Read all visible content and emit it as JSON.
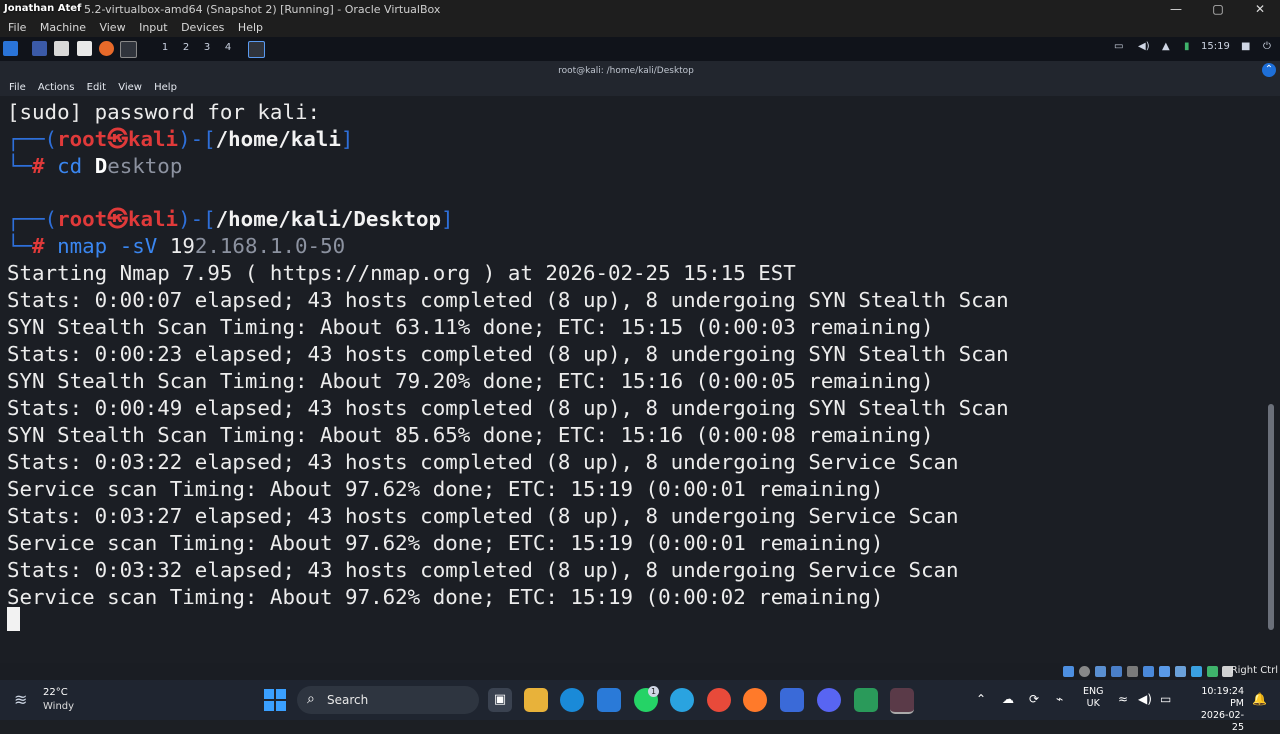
{
  "host_window": {
    "user_badge": "Jonathan Atef",
    "title": "5.2-virtualbox-amd64 (Snapshot 2) [Running] - Oracle VirtualBox",
    "menu": [
      "File",
      "Machine",
      "View",
      "Input",
      "Devices",
      "Help"
    ],
    "controls": {
      "minimize": "—",
      "maximize": "▢",
      "close": "✕"
    }
  },
  "kali_panel": {
    "workspaces": [
      "1",
      "2",
      "3",
      "4"
    ],
    "clock": "15:19"
  },
  "terminal": {
    "title": "root@kali: /home/kali/Desktop",
    "menu": [
      "File",
      "Actions",
      "Edit",
      "View",
      "Help"
    ],
    "sudo_prompt": "[sudo] password for kali:",
    "prompt1": {
      "user": "root",
      "host": "kali",
      "path": "/home/kali",
      "cmd": "cd",
      "arg_bright": "D",
      "arg_dim": "esktop"
    },
    "prompt2": {
      "user": "root",
      "host": "kali",
      "path": "/home/kali/Desktop",
      "cmd": "nmap",
      "flag": "-sV",
      "arg_bright": "19",
      "arg_dim": "2.168.1.0-50"
    },
    "output": [
      "Starting Nmap 7.95 ( https://nmap.org ) at 2026-02-25 15:15 EST",
      "Stats: 0:00:07 elapsed; 43 hosts completed (8 up), 8 undergoing SYN Stealth Scan",
      "SYN Stealth Scan Timing: About 63.11% done; ETC: 15:15 (0:00:03 remaining)",
      "Stats: 0:00:23 elapsed; 43 hosts completed (8 up), 8 undergoing SYN Stealth Scan",
      "SYN Stealth Scan Timing: About 79.20% done; ETC: 15:16 (0:00:05 remaining)",
      "Stats: 0:00:49 elapsed; 43 hosts completed (8 up), 8 undergoing SYN Stealth Scan",
      "SYN Stealth Scan Timing: About 85.65% done; ETC: 15:16 (0:00:08 remaining)",
      "Stats: 0:03:22 elapsed; 43 hosts completed (8 up), 8 undergoing Service Scan",
      "Service scan Timing: About 97.62% done; ETC: 15:19 (0:00:01 remaining)",
      "Stats: 0:03:27 elapsed; 43 hosts completed (8 up), 8 undergoing Service Scan",
      "Service scan Timing: About 97.62% done; ETC: 15:19 (0:00:01 remaining)",
      "Stats: 0:03:32 elapsed; 43 hosts completed (8 up), 8 undergoing Service Scan",
      "Service scan Timing: About 97.62% done; ETC: 15:19 (0:00:02 remaining)"
    ]
  },
  "vb_status": {
    "host_key": "Right Ctrl"
  },
  "taskbar": {
    "weather": {
      "temp": "22°C",
      "desc": "Windy"
    },
    "search_label": "Search",
    "lang": {
      "line1": "ENG",
      "line2": "UK"
    },
    "clock": {
      "time": "10:19:24 PM",
      "date": "2026-02-25"
    },
    "whatsapp_badge": "1"
  },
  "colors": {
    "prompt_blue": "#2e6fd9",
    "prompt_red": "#e03a3a",
    "accent": "#3aa0ff"
  }
}
